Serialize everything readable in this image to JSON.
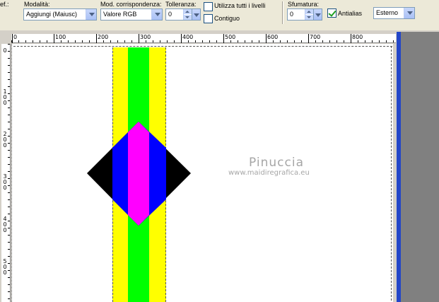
{
  "toolbar": {
    "cut_label": "ef.:",
    "modalita": {
      "label": "Modalità:",
      "value": "Aggiungi (Maiusc)"
    },
    "corrispondenza": {
      "label": "Mod. corrispondenza:",
      "value": "Valore RGB"
    },
    "tolleranza": {
      "label": "Tolleranza:",
      "value": "0"
    },
    "utilizza_livelli": {
      "label": "Utilizza tutti i livelli",
      "checked": false
    },
    "contiguo": {
      "label": "Contiguo",
      "checked": false
    },
    "sfumatura": {
      "label": "Sfumatura:",
      "value": "0"
    },
    "antialias": {
      "label": "Antialias",
      "checked": true
    },
    "mode": {
      "value": "Esterno"
    }
  },
  "ruler": {
    "horizontal": [
      "0",
      "100",
      "200",
      "300",
      "400",
      "500",
      "600",
      "700",
      "800"
    ],
    "vertical": [
      "0",
      "1\n0\n0",
      "2\n0\n0",
      "3\n0\n0",
      "4\n0\n0",
      "5\n0\n0"
    ]
  },
  "canvas": {
    "watermark_name": "Pinuccia",
    "watermark_url": "www.maidiregrafica.eu",
    "colors": {
      "yellow": "#ffff00",
      "green": "#00ff00",
      "black": "#000000",
      "blue": "#0000ff",
      "magenta": "#ff00ff",
      "white": "#ffffff"
    }
  }
}
